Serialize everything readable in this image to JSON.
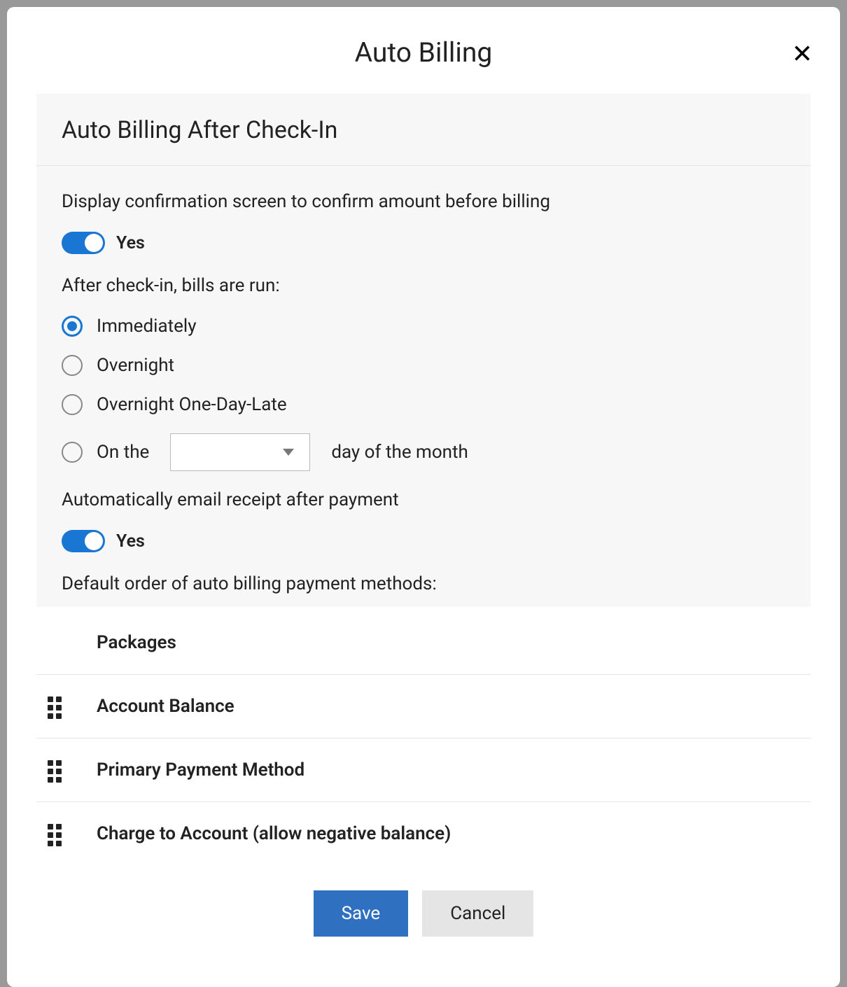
{
  "modal": {
    "title": "Auto Billing"
  },
  "panel": {
    "title": "Auto Billing After Check-In",
    "confirmLabel": "Display confirmation screen to confirm amount before billing",
    "confirmToggle": "Yes",
    "billsRunLabel": "After check-in, bills are run:",
    "radio": {
      "immediately": "Immediately",
      "overnight": "Overnight",
      "overnightLate": "Overnight One-Day-Late",
      "onThePrefix": "On the",
      "onTheSuffix": "day of the month"
    },
    "emailReceiptLabel": "Automatically email receipt after payment",
    "emailReceiptToggle": "Yes",
    "orderLabel": "Default order of auto billing payment methods:"
  },
  "paymentMethods": {
    "packages": "Packages",
    "accountBalance": "Account Balance",
    "primary": "Primary Payment Method",
    "charge": "Charge to Account (allow negative balance)"
  },
  "footer": {
    "save": "Save",
    "cancel": "Cancel"
  }
}
